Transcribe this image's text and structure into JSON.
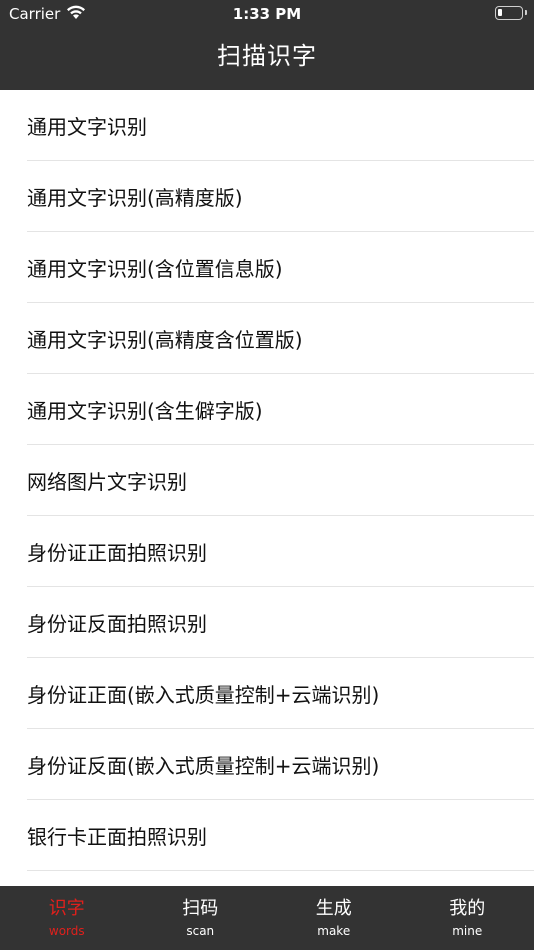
{
  "status_bar": {
    "carrier": "Carrier",
    "time": "1:33 PM",
    "wifi_icon": "wifi-icon",
    "battery_icon": "battery-icon"
  },
  "nav": {
    "title": "扫描识字"
  },
  "list": {
    "items": [
      {
        "label": "通用文字识别"
      },
      {
        "label": "通用文字识别(高精度版)"
      },
      {
        "label": "通用文字识别(含位置信息版)"
      },
      {
        "label": "通用文字识别(高精度含位置版)"
      },
      {
        "label": "通用文字识别(含生僻字版)"
      },
      {
        "label": "网络图片文字识别"
      },
      {
        "label": "身份证正面拍照识别"
      },
      {
        "label": "身份证反面拍照识别"
      },
      {
        "label": "身份证正面(嵌入式质量控制+云端识别)"
      },
      {
        "label": "身份证反面(嵌入式质量控制+云端识别)"
      },
      {
        "label": "银行卡正面拍照识别"
      }
    ]
  },
  "tabbar": {
    "tabs": [
      {
        "label": "识字",
        "sub": "words",
        "active": true
      },
      {
        "label": "扫码",
        "sub": "scan",
        "active": false
      },
      {
        "label": "生成",
        "sub": "make",
        "active": false
      },
      {
        "label": "我的",
        "sub": "mine",
        "active": false
      }
    ]
  },
  "colors": {
    "bar_background": "#333333",
    "active_tab": "#e0201c",
    "inactive_tab": "#ffffff",
    "separator": "#e4e4e4"
  }
}
